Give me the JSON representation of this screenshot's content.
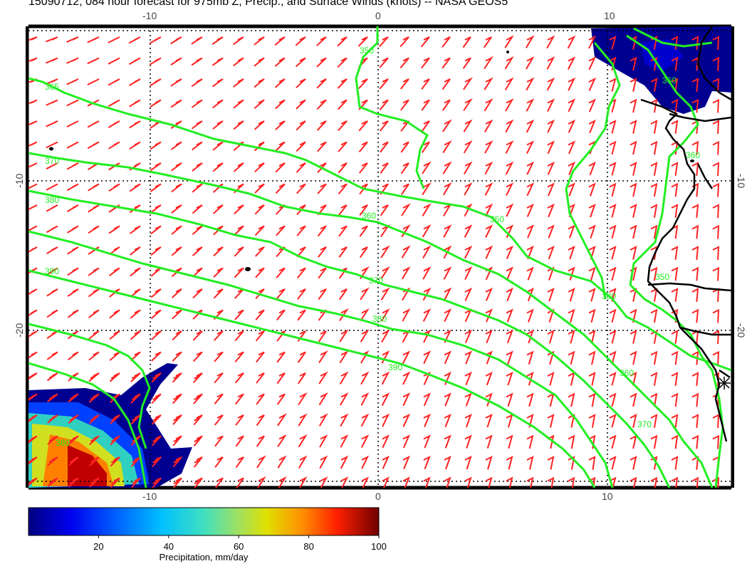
{
  "title": "15090712, 084 hour forecast for 975mb Z, Precip., and Surface Winds (knots) -- NASA GEOS5",
  "map": {
    "lon_range": [
      -15,
      15.5
    ],
    "lat_range": [
      -27.5,
      2.5
    ],
    "grid_lons": [
      -10,
      0,
      10
    ],
    "grid_lats": [
      -10,
      -20
    ],
    "tick_labels_lon": [
      "-10",
      "0",
      "10"
    ],
    "tick_labels_lat": [
      "-10",
      "-20"
    ],
    "contour_color": "#22ee22",
    "barb_color": "#ff2222",
    "coast_color": "#000000",
    "contour_labels": [
      "360",
      "365",
      "370",
      "380",
      "390",
      "350",
      "360",
      "370",
      "380",
      "350",
      "390",
      "380",
      "360",
      "370",
      "360",
      "350",
      "360",
      "380"
    ]
  },
  "colorbar": {
    "label": "Precipitation, mm/day",
    "ticks": [
      "20",
      "40",
      "60",
      "80",
      "100"
    ],
    "tick_values": [
      20,
      40,
      60,
      80,
      100
    ],
    "min": 0,
    "max": 100,
    "colors": [
      "#000080",
      "#0000ee",
      "#0060ff",
      "#00b0ff",
      "#20e0e0",
      "#60f0a0",
      "#b0e040",
      "#e0e000",
      "#ff9000",
      "#ff3000",
      "#c00000",
      "#800000"
    ]
  }
}
